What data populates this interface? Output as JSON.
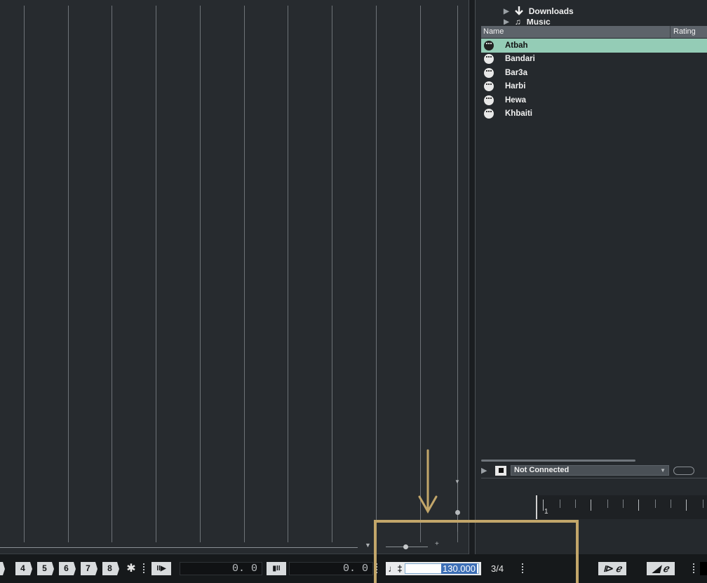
{
  "media_bay": {
    "tree": [
      {
        "label": "Downloads",
        "icon": "download-arrow-icon"
      },
      {
        "label": "Music",
        "icon": "music-note-icon"
      }
    ],
    "columns": {
      "name": "Name",
      "rating": "Rating"
    },
    "items": [
      {
        "label": "Atbah",
        "selected": true
      },
      {
        "label": "Bandari"
      },
      {
        "label": "Bar3a"
      },
      {
        "label": "Harbi"
      },
      {
        "label": "Hewa"
      },
      {
        "label": "Khbaiti"
      }
    ],
    "preview": {
      "port": "Not Connected",
      "keyboard_label": "1"
    }
  },
  "transport": {
    "locate_buttons": [
      "4",
      "5",
      "6",
      "7",
      "8"
    ],
    "left_locator": "0.     0",
    "right_locator": "0.     0",
    "tempo": "130.000",
    "signature": "3/4"
  },
  "colors": {
    "selection": "#94ccb6",
    "annotation": "#c2a66a",
    "tempo_highlight": "#3d6fb6"
  }
}
